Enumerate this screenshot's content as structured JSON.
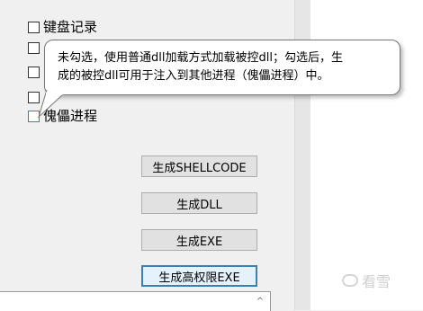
{
  "checkboxes": [
    {
      "label": "键盘记录",
      "checked": false
    },
    {
      "label": "",
      "checked": false
    },
    {
      "label": "",
      "checked": false
    },
    {
      "label": "",
      "checked": false
    },
    {
      "label": "傀儡进程",
      "checked": false
    }
  ],
  "tooltip": {
    "line1": "未勾选，使用普通dll加载方式加载被控dll；勾选后，生",
    "line2": "成的被控dll可用于注入到其他进程（傀儡进程）中。"
  },
  "buttons": {
    "gen_shellcode": "生成SHELLCODE",
    "gen_dll": "生成DLL",
    "gen_exe": "生成EXE",
    "gen_high_priv_exe": "生成高权限EXE"
  },
  "bottom": {
    "scroll_arrow": "^"
  },
  "watermark": {
    "text": "看雪"
  }
}
